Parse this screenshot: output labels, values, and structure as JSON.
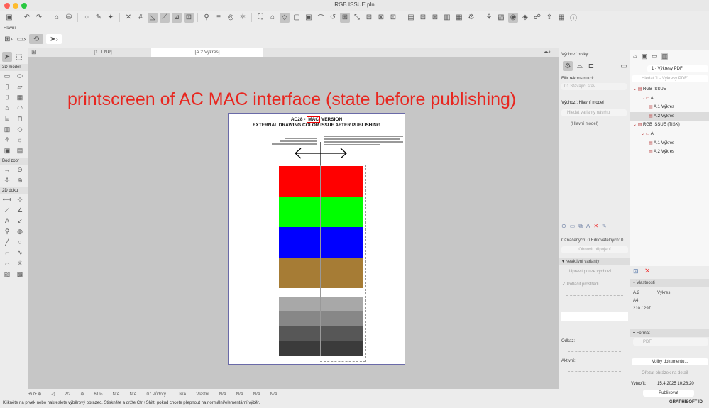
{
  "window": {
    "title": "RGB ISSUE.pln"
  },
  "toolbar2": {
    "label": "Hlavní"
  },
  "tabs": [
    {
      "label": "[1. 1.NP]"
    },
    {
      "label": "[A.2 Výkres]"
    }
  ],
  "toolbox": {
    "sections": [
      "3D model",
      "Bod zobr",
      "2D doku"
    ]
  },
  "annotation": "printscreen of AC MAC interface (state before publishing)",
  "sheet": {
    "line1_pre": "AC28 - ",
    "line1_mark": "MAC",
    "line1_post": " VERSION",
    "line2": "EXTERNAL DRAWING COLOR ISSUE AFTER PUBLISHING",
    "swatches": [
      "#ff0000",
      "#00ff00",
      "#0000ff",
      "#a67c35"
    ],
    "grays": [
      "#a8a8a8",
      "#878787",
      "#575757",
      "#3b3b3b"
    ]
  },
  "middle": {
    "default_items": "Výchozí prvky:",
    "filter_label": "Filtr rekonstrukcí:",
    "filter_value": "01 Stávající stav",
    "default_model": "Výchozí: Hlavní model",
    "search_placeholder": "Hledat varianty návrhu",
    "main_model": "(Hlavní model)",
    "counts": "Označených: 0 Editovatelných: 0",
    "refresh": "Obnovit připojení",
    "inactive": "Neaktivní varianty",
    "edit_default": "Upravit pouze výchozí",
    "suppress_env": "Potlačit prostředí",
    "ref_label": "Odkaz:",
    "active_label": "Aktivní:"
  },
  "navigator": {
    "set": "1 - Výkresy PDF",
    "search_placeholder": "Hledat '1 - Výkresy PDF'",
    "tree": [
      {
        "label": "RGB ISSUE",
        "level": 0
      },
      {
        "label": "A",
        "level": 1
      },
      {
        "label": "A.1 Výkres",
        "level": 2
      },
      {
        "label": "A.2 Výkres",
        "level": 2,
        "selected": true
      },
      {
        "label": "RGB ISSUE (TISK)",
        "level": 0
      },
      {
        "label": "A",
        "level": 1
      },
      {
        "label": "A.1 Výkres",
        "level": 2
      },
      {
        "label": "A.2 Výkres",
        "level": 2
      }
    ]
  },
  "properties": {
    "header": "Vlastnosti",
    "id": "A.2",
    "name": "Výkres",
    "size": "A4",
    "dims": "210 / 297",
    "format_header": "Formát",
    "format": "PDF",
    "doc_options": "Volby dokumentu...",
    "crop": "Ořezat obrázek na detail",
    "created_label": "Vytvořit:",
    "created": "15.4.2025 10:28:20",
    "publish": "Publikovat",
    "brand": "GRAPHISOFT ID"
  },
  "status": {
    "page": "2/2",
    "zoom": "61%",
    "na": "N/A",
    "view": "07 Půdory...",
    "pen": "Vlastní",
    "hint": "Klikněte na prvek nebo nakreslete výběrový obrazec. Stiskněte a držte Ctrl+Shift, pokud chcete přepnout na normální/elementární výběr."
  }
}
